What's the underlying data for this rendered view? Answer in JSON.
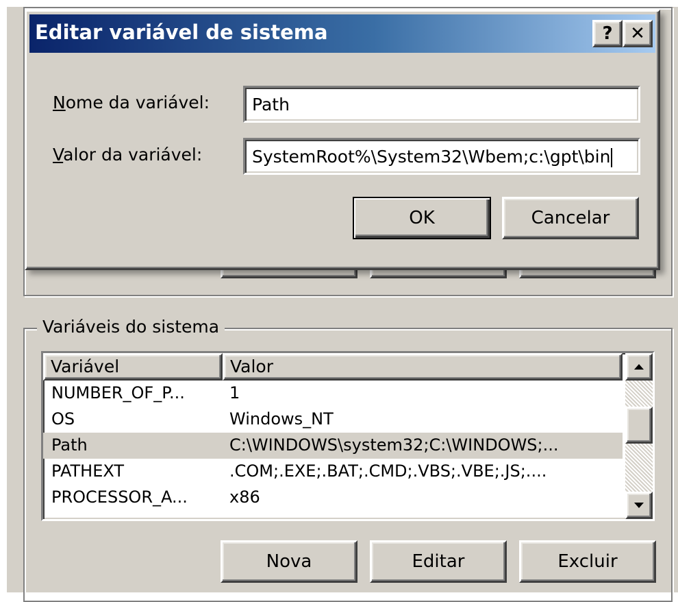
{
  "background_window": {
    "top_buttons": [
      "",
      "",
      ""
    ],
    "system_group": {
      "title": "Variáveis do sistema",
      "columns": [
        "Variável",
        "Valor"
      ],
      "rows": [
        {
          "name": "NUMBER_OF_P...",
          "value": "1"
        },
        {
          "name": "OS",
          "value": "Windows_NT"
        },
        {
          "name": "Path",
          "value": "C:\\WINDOWS\\system32;C:\\WINDOWS;..."
        },
        {
          "name": "PATHEXT",
          "value": ".COM;.EXE;.BAT;.CMD;.VBS;.VBE;.JS;...."
        },
        {
          "name": "PROCESSOR_A...",
          "value": "x86"
        }
      ],
      "selected_row": "Path",
      "buttons": {
        "new": "Nova",
        "edit": "Editar",
        "delete": "Excluir"
      }
    }
  },
  "dialog": {
    "title": "Editar variável de sistema",
    "help_glyph": "?",
    "close_glyph": "✕",
    "name_label_accel": "N",
    "name_label_rest": "ome da variável:",
    "name_value": "Path",
    "value_label_accel": "V",
    "value_label_rest": "alor da variável:",
    "value_value": "SystemRoot%\\System32\\Wbem;c:\\gpt\\bin",
    "ok_label": "OK",
    "cancel_label": "Cancelar",
    "colors": {
      "title_from": "#0a246a",
      "title_to": "#ffffff",
      "face": "#d4d0c8",
      "selection": "#d4d0c8"
    }
  }
}
